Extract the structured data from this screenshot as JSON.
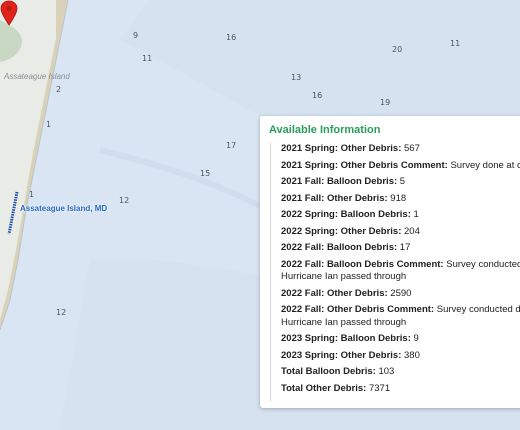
{
  "map": {
    "island_label": "Assateague Island",
    "site_label": "Assateague Island, MD",
    "depth_labels": [
      "9",
      "16",
      "20",
      "11",
      "11",
      "2",
      "13",
      "16",
      "19",
      "1",
      "17",
      "15",
      "1",
      "12",
      "12"
    ],
    "colors": {
      "water": "#d9e5f2",
      "land": "#e9ece6",
      "beach": "#d9d2b8",
      "pin": "#e0241c",
      "track": "#2466c7"
    }
  },
  "popup": {
    "title": "Available Information",
    "title_color": "#2a9d5c",
    "rows": [
      {
        "label": "2021 Spring: Other Debris:",
        "value": "567"
      },
      {
        "label": "2021 Spring: Other Debris Comment:",
        "value": "Survey done at o"
      },
      {
        "label": "2021 Fall: Balloon Debris:",
        "value": "5"
      },
      {
        "label": "2021 Fall: Other Debris:",
        "value": "918"
      },
      {
        "label": "2022 Spring: Balloon Debris:",
        "value": "1"
      },
      {
        "label": "2022 Spring: Other Debris:",
        "value": "204"
      },
      {
        "label": "2022 Fall: Balloon Debris:",
        "value": "17"
      },
      {
        "label": "2022 Fall: Balloon Debris Comment:",
        "value": "Survey conducted of Hurricane Ian passed through"
      },
      {
        "label": "2022 Fall: Other Debris:",
        "value": "2590"
      },
      {
        "label": "2022 Fall: Other Debris Comment:",
        "value": "Survey conducted d Hurricane Ian passed through"
      },
      {
        "label": "2023 Spring: Balloon Debris:",
        "value": "9"
      },
      {
        "label": "2023 Spring: Other Debris:",
        "value": "380"
      },
      {
        "label": "Total Balloon Debris:",
        "value": "103"
      },
      {
        "label": "Total Other Debris:",
        "value": "7371"
      }
    ]
  }
}
